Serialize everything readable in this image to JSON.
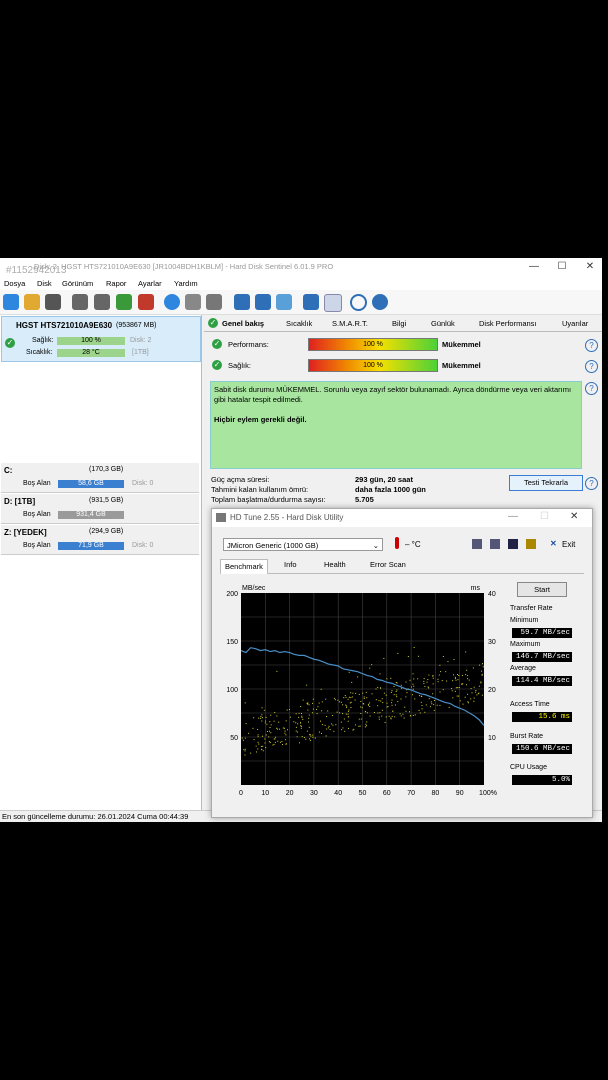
{
  "window": {
    "title": "Disk: 2, HGST HTS721010A9E630 [JR1004BDH1KBLM]  -  Hard Disk Sentinel 6.01.9 PRO",
    "watermark": "#1152942013",
    "controls": {
      "minimize": "—",
      "maximize": "☐",
      "close": "✕"
    }
  },
  "menu": [
    "Dosya",
    "Disk",
    "Görünüm",
    "Rapor",
    "Ayarlar",
    "Yardım"
  ],
  "toolbar_icons": [
    "refresh-icon",
    "refresh-all-icon",
    "list-icon",
    "drive-a-icon",
    "drive-b-icon",
    "drive-c-icon",
    "drive-d-icon",
    "globe-icon",
    "tools-icon",
    "print-icon",
    "report-icon",
    "mail-icon",
    "network-icon",
    "settings-icon",
    "alert-off-icon",
    "help-icon",
    "info-icon"
  ],
  "disk": {
    "name": "HGST HTS721010A9E630",
    "size": "(953867 MB)",
    "health_label": "Sağlık:",
    "health_value": "100 %",
    "health_fraction": 1.0,
    "disk_ref": "Disk: 2",
    "temp_label": "Sıcaklık:",
    "temp_value": "28 °C",
    "tb": "[1TB]"
  },
  "volumes": [
    {
      "label": "C:",
      "total": "(170,3 GB)",
      "free_label": "Boş Alan",
      "free": "58,6 GB",
      "disk": "Disk: 0",
      "free_fraction": 0.34,
      "color": "#3b7fd1"
    },
    {
      "label": "D: [1TB]",
      "total": "(931,5 GB)",
      "free_label": "Boş Alan",
      "free": "931,4 GB",
      "disk": "",
      "free_fraction": 1.0,
      "color": "#9a9a9a"
    },
    {
      "label": "Z: [YEDEK]",
      "total": "(294,9 GB)",
      "free_label": "Boş Alan",
      "free": "71,9 GB",
      "disk": "Disk: 0",
      "free_fraction": 0.24,
      "color": "#3b7fd1"
    }
  ],
  "tabs": [
    "Genel bakış",
    "Sıcaklık",
    "S.M.A.R.T.",
    "Bilgi",
    "Günlük",
    "Disk Performansı",
    "Uyarılar"
  ],
  "overview": {
    "perf_label": "Performans:",
    "perf_value": "100 %",
    "perf_rating": "Mükemmel",
    "health_label": "Sağlık:",
    "health_value": "100 %",
    "health_rating": "Mükemmel",
    "message": "Sabit disk durumu MÜKEMMEL. Sorunlu veya zayıf sektör bulunamadı. Ayrıca döndürme veya veri aktarımı gibi hatalar tespit edilmedi.",
    "action": "Hiçbir eylem gerekli değil.",
    "power_on_label": "Güç açma süresi:",
    "power_on_value": "293 gün, 20 saat",
    "remaining_label": "Tahmini kalan kullanım ömrü:",
    "remaining_value": "daha fazla 1000 gün",
    "starts_label": "Toplam başlatma/durdurma sayısı:",
    "starts_value": "5.705",
    "repeat_button": "Testi Tekrarla"
  },
  "status_bar": "En son güncelleme durumu: 26.01.2024 Cuma 00:44:39",
  "hdtune": {
    "title": "HD Tune 2.55 - Hard Disk Utility",
    "drive": "JMicron Generic (1000 GB)",
    "temp": "– °C",
    "exit": "Exit",
    "tabs": [
      "Benchmark",
      "Info",
      "Health",
      "Error Scan"
    ],
    "start": "Start",
    "transfer_rate": "Transfer Rate",
    "min_label": "Minimum",
    "min": "59.7 MB/sec",
    "max_label": "Maximum",
    "max": "146.7 MB/sec",
    "avg_label": "Average",
    "avg": "114.4 MB/sec",
    "access_label": "Access Time",
    "access": "15.6 ms",
    "burst_label": "Burst Rate",
    "burst": "150.6 MB/sec",
    "cpu_label": "CPU Usage",
    "cpu": "5.0%"
  },
  "chart_data": {
    "type": "line",
    "xlabel": "",
    "ylabel_left": "MB/sec",
    "ylabel_right": "ms",
    "xlim": [
      0,
      100
    ],
    "ylim": [
      0,
      200
    ],
    "ylim_right": [
      0,
      40
    ],
    "x_ticks": [
      "0",
      "10",
      "20",
      "30",
      "40",
      "50",
      "60",
      "70",
      "80",
      "90",
      "100%"
    ],
    "y_ticks": [
      "200",
      "150",
      "100",
      "50"
    ],
    "y_ticks_right": [
      "40",
      "30",
      "20",
      "10"
    ],
    "grid": true,
    "series": [
      {
        "color": "#4a90c8",
        "x": [
          0,
          2,
          4,
          6,
          8,
          10,
          12,
          14,
          16,
          18,
          20,
          22,
          24,
          26,
          28,
          30,
          32,
          34,
          36,
          38,
          40,
          42,
          44,
          46,
          48,
          50,
          52,
          54,
          56,
          58,
          60,
          62,
          64,
          66,
          68,
          70,
          72,
          74,
          76,
          78,
          80,
          82,
          84,
          86,
          88,
          90,
          92,
          94,
          96,
          98,
          100
        ],
        "values": [
          140,
          138,
          143,
          142,
          140,
          141,
          139,
          140,
          138,
          139,
          138,
          136,
          135,
          135,
          133,
          131,
          130,
          128,
          126,
          125,
          124,
          121,
          120,
          119,
          118,
          116,
          114,
          113,
          110,
          109,
          107,
          106,
          104,
          102,
          100,
          99,
          97,
          95,
          94,
          92,
          90,
          88,
          86,
          85,
          82,
          80,
          78,
          75,
          72,
          68,
          62
        ]
      }
    ],
    "access_points": "scatter of yellow points, roughly 10–25 ms"
  }
}
